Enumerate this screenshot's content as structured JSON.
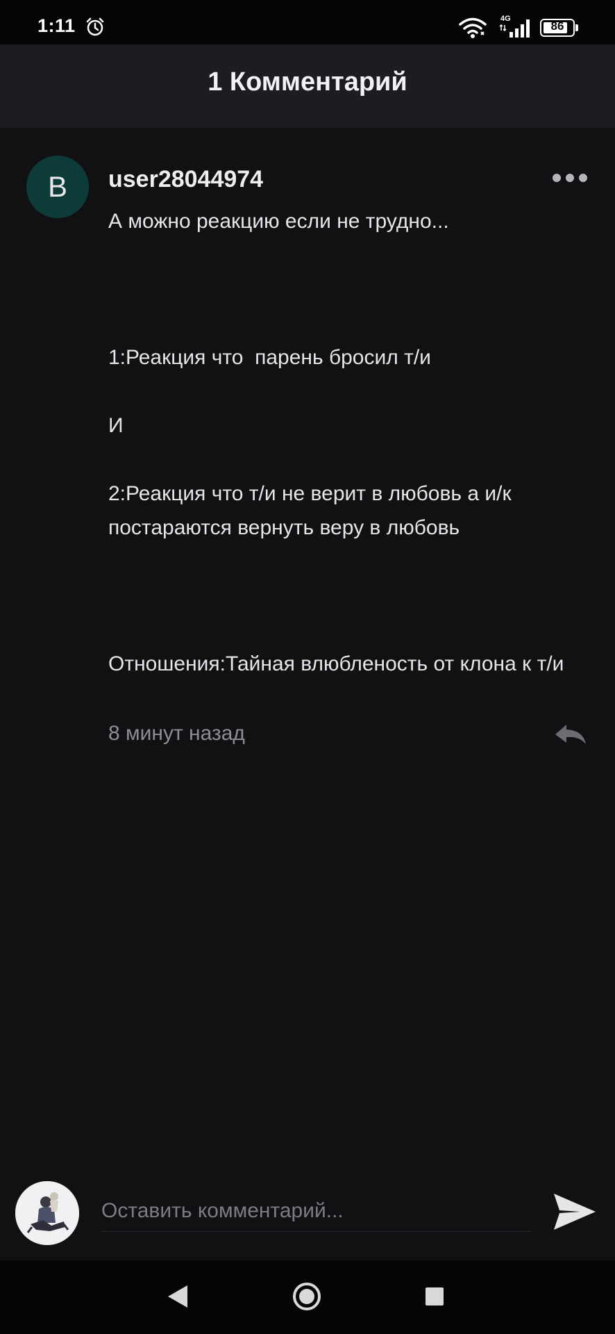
{
  "status_bar": {
    "time": "1:11",
    "network": "4G",
    "battery": "86",
    "battery_level": 0.86,
    "icons": [
      "alarm-icon",
      "wifi-icon",
      "signal-icon",
      "battery-icon"
    ]
  },
  "header": {
    "title": "1 Комментарий"
  },
  "comment": {
    "avatar_letter": "B",
    "avatar_color": "#0d3b37",
    "author": "user28044974",
    "lines": [
      "А можно реакцию если не трудно...",
      "",
      "",
      "",
      "1:Реакция что  парень бросил т/и",
      "",
      "И",
      "",
      "2:Реакция что т/и не верит в любовь а и/к постараются вернуть веру в любовь",
      "",
      "",
      "",
      "Отношения:Тайная влюбленость от клона к т/и"
    ],
    "time": "8 минут назад",
    "icons": [
      "more-icon",
      "reply-icon"
    ]
  },
  "input": {
    "placeholder": "Оставить комментарий...",
    "value": "",
    "icons": [
      "user-avatar",
      "send-icon"
    ]
  },
  "nav": {
    "icons": [
      "back-icon",
      "home-icon",
      "recents-icon"
    ]
  }
}
